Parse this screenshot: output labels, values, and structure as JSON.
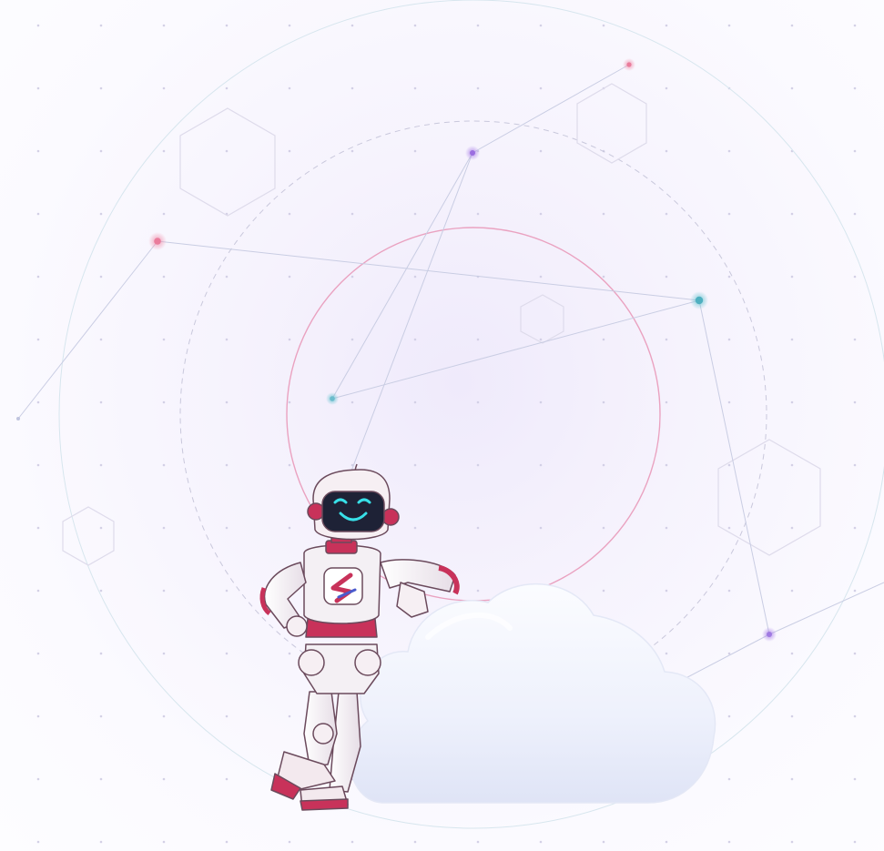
{
  "scene": {
    "description_free": true,
    "colors": {
      "background": "#faf9fe",
      "accent_pink": "#e0709a",
      "accent_purple": "#9b6ee0",
      "accent_teal": "#4fb0c0",
      "robot_body": "#f4f0f4",
      "robot_accent": "#c8325a",
      "robot_screen": "#1e2236",
      "robot_face_glow": "#38e0e8",
      "cloud": "#eef1fc"
    },
    "icons": [
      "network-node-icon",
      "hexagon-icon",
      "robot-mascot",
      "cloud-illustration",
      "logo-s-icon"
    ]
  }
}
